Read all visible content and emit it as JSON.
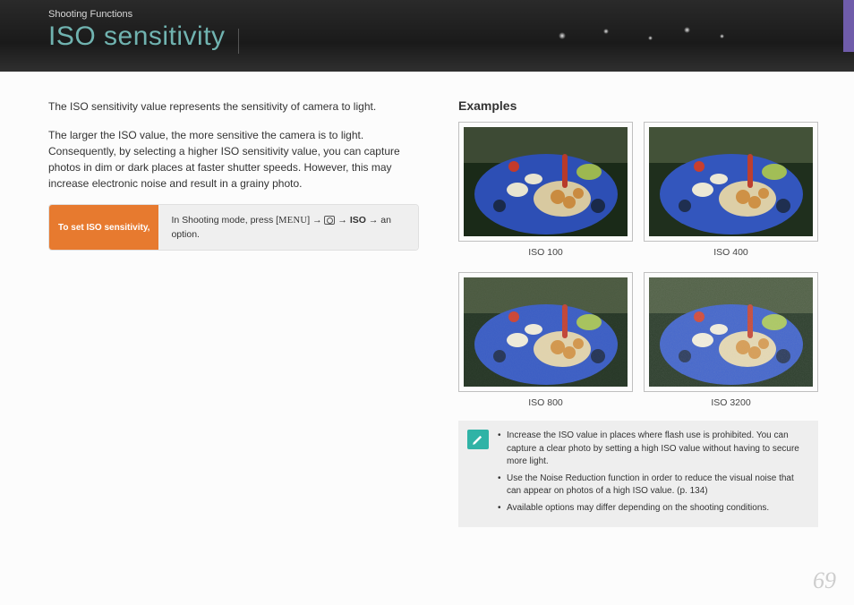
{
  "header": {
    "breadcrumb": "Shooting Functions",
    "title": "ISO sensitivity"
  },
  "body": {
    "para1": "The ISO sensitivity value represents the sensitivity of camera to light.",
    "para2": "The larger the ISO value, the more sensitive the camera is to light. Consequently, by selecting a higher ISO sensitivity value, you can capture photos in dim or dark places at faster shutter speeds. However, this may increase electronic noise and result in a grainy photo."
  },
  "instruction": {
    "label": "To set ISO sensitivity,",
    "prefix": "In Shooting mode, press [",
    "menu": "MENU",
    "mid1": "] ",
    "arrow": "→",
    "mid2": " ",
    "iso_bold": "ISO",
    "suffix": " an option."
  },
  "examples": {
    "title": "Examples",
    "items": [
      {
        "caption": "ISO 100"
      },
      {
        "caption": "ISO 400"
      },
      {
        "caption": "ISO 800"
      },
      {
        "caption": "ISO 3200"
      }
    ]
  },
  "tips": {
    "items": [
      "Increase the ISO value in places where flash use is prohibited. You can capture a clear photo by setting a high ISO value without having to secure more light.",
      "Use the Noise Reduction function in order to reduce the visual noise that can appear on photos of a high ISO value. (p. 134)",
      "Available options may differ depending on the shooting conditions."
    ]
  },
  "page_number": "69"
}
